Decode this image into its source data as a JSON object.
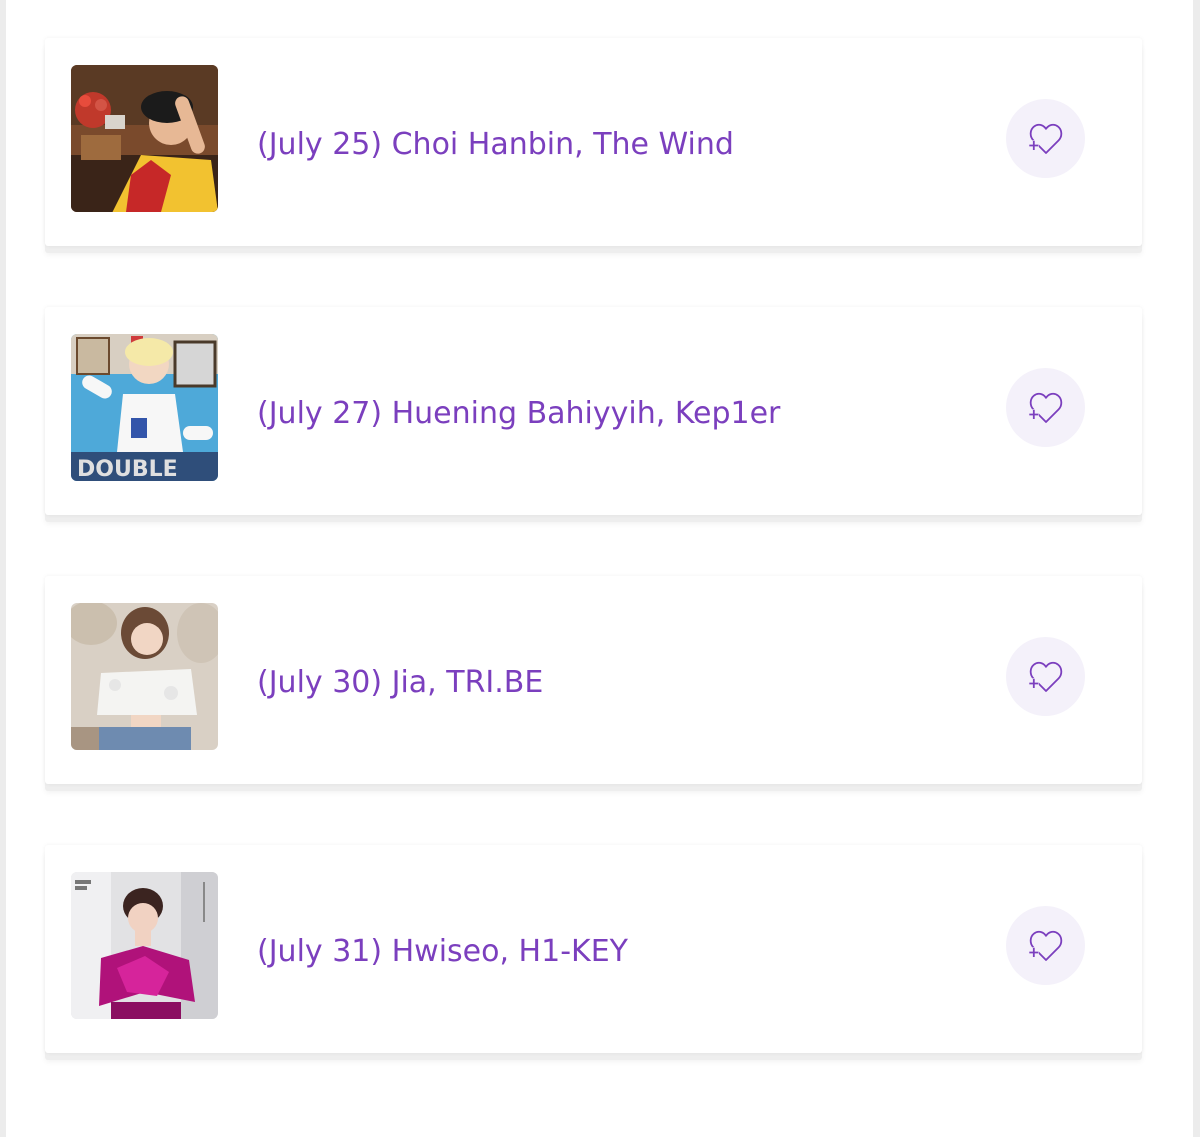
{
  "theme": {
    "title_color": "#7b3fbe",
    "fav_bg": "#f4f1fa",
    "card_bg": "#ffffff"
  },
  "items": [
    {
      "title": "(July 25) Choi Hanbin, The Wind",
      "thumbnail_icon": "photo-choi-hanbin",
      "favorite_icon": "heart-plus-icon"
    },
    {
      "title": "(July 27) Huening Bahiyyih, Kep1er",
      "thumbnail_icon": "photo-huening-bahiyyih",
      "favorite_icon": "heart-plus-icon"
    },
    {
      "title": "(July 30) Jia, TRI.BE",
      "thumbnail_icon": "photo-jia",
      "favorite_icon": "heart-plus-icon"
    },
    {
      "title": "(July 31) Hwiseo, H1-KEY",
      "thumbnail_icon": "photo-hwiseo",
      "favorite_icon": "heart-plus-icon"
    }
  ]
}
